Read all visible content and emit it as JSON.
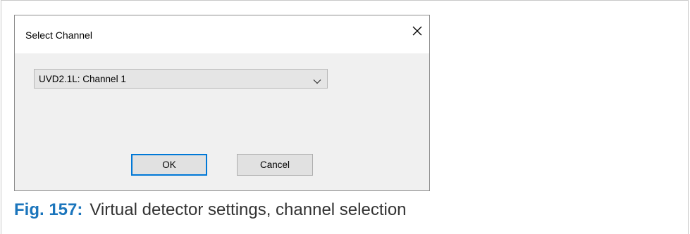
{
  "dialog": {
    "title": "Select Channel",
    "close_icon": "close-icon"
  },
  "channel_select": {
    "selected": "UVD2.1L: Channel 1",
    "arrow_icon": "chevron-down-icon"
  },
  "buttons": {
    "ok_label": "OK",
    "cancel_label": "Cancel"
  },
  "caption": {
    "label": "Fig. 157:",
    "text": "Virtual detector settings, channel selection"
  },
  "colors": {
    "caption_accent": "#1b75bc",
    "focus_border": "#0078d7",
    "dialog_bg": "#f0f0f0"
  }
}
